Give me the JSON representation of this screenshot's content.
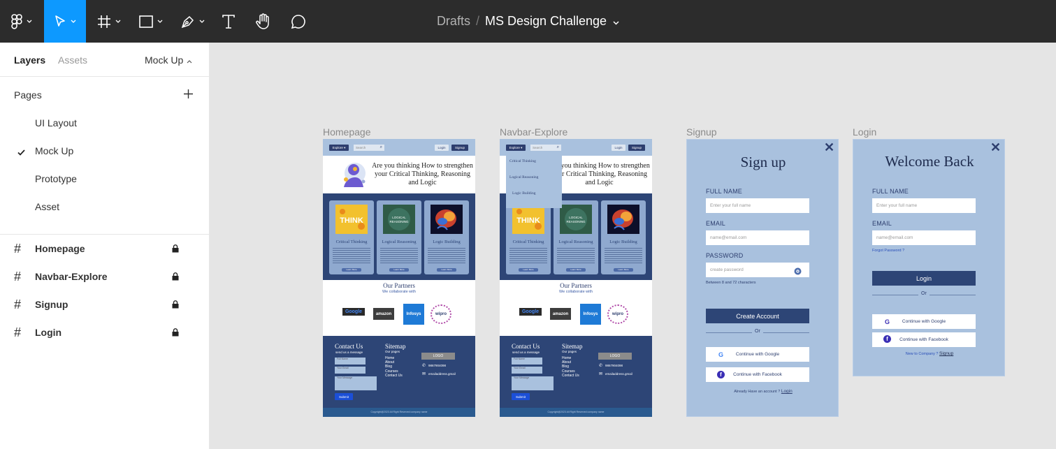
{
  "toolbar": {
    "breadcrumb_parent": "Drafts",
    "separator": "/",
    "file_name": "MS Design Challenge",
    "active_tool": "move",
    "accent": "#0d99ff"
  },
  "sidebar": {
    "tabs": [
      "Layers",
      "Assets"
    ],
    "current_page_selector": "Mock Up",
    "pages_title": "Pages",
    "pages": [
      {
        "label": "UI Layout",
        "checked": false
      },
      {
        "label": "Mock Up",
        "checked": true
      },
      {
        "label": "Prototype",
        "checked": false
      },
      {
        "label": "Asset",
        "checked": false
      }
    ],
    "layers": [
      {
        "label": "Homepage",
        "locked": true
      },
      {
        "label": "Navbar-Explore",
        "locked": true
      },
      {
        "label": "Signup",
        "locked": true
      },
      {
        "label": "Login",
        "locked": true
      }
    ]
  },
  "frames": {
    "homepage": {
      "label": "Homepage",
      "nav": {
        "explore": "Explore ▾",
        "search": "Search",
        "login": "Login",
        "signup": "Signup"
      },
      "hero": "Are you thinking How to strengthen your Critical Thinking, Reasoning and Logic",
      "cards": [
        {
          "title": "Critical Thinking",
          "button": "Learn More"
        },
        {
          "title": "Logical Reasoning",
          "button": "Learn More"
        },
        {
          "title": "Logic Building",
          "button": "Learn More"
        }
      ],
      "partners_title": "Our Partners",
      "partners_sub": "We collaborate with",
      "partners": [
        "Google",
        "amazon",
        "Infosys",
        "wipro"
      ],
      "footer": {
        "contact_title": "Contact Us",
        "contact_sub": "send us a message",
        "fields": [
          "Full Name",
          "Your Email",
          "Your Message"
        ],
        "submit": "Submit",
        "sitemap_title": "Sitemap",
        "sitemap_sub": "Our pages",
        "sitemap_links": [
          "Home",
          "About",
          "Blog",
          "Courses",
          "Contact Us"
        ],
        "logo": "LOGO",
        "phone": "9867904098",
        "email": "emailaddress.gmail",
        "copyright": "Copyright@2023 All Right Reserved company name"
      }
    },
    "navbar_explore": {
      "label": "Navbar-Explore",
      "dropdown": [
        "Critical Thinking",
        "Logical Reasoning",
        "Logic Building"
      ]
    },
    "signup": {
      "label": "Signup",
      "title": "Sign up",
      "full_name_label": "FULL NAME",
      "full_name_placeholder": "Enter your full name",
      "email_label": "EMAIL",
      "email_placeholder": "name@email.com",
      "password_label": "PASSWORD",
      "password_placeholder": "create password",
      "password_hint": "Between 8 and 72 characters",
      "create_button": "Create Account",
      "or": "Or",
      "google": "Continue with Google",
      "facebook": "Continue with Facebook",
      "have_account": "Already Have an account ?",
      "login_link": "Login"
    },
    "login": {
      "label": "Login",
      "title": "Welcome Back",
      "full_name_label": "FULL NAME",
      "full_name_placeholder": "Enter your full name",
      "email_label": "EMAIL",
      "email_placeholder": "name@email.com",
      "forgot": "Forgot Password ?",
      "login_button": "Login",
      "or": "Or",
      "google": "Continue with Google",
      "facebook": "Continue with Facebook",
      "new_here": "New to Company ?",
      "signup_link": "Signup"
    }
  },
  "colors": {
    "toolbar_bg": "#2c2c2c",
    "canvas_bg": "#e5e5e5",
    "frame_blue": "#a9c1de",
    "navy": "#2d4576"
  }
}
